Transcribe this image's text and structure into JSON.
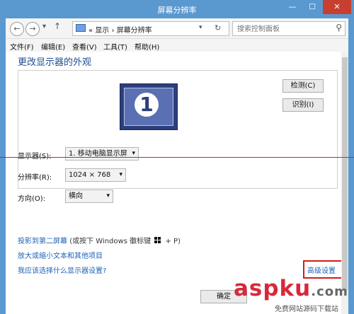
{
  "window": {
    "title": "屏幕分辨率",
    "minimize": "—",
    "maximize": "☐",
    "close": "✕"
  },
  "toolbar": {
    "back": "←",
    "forward": "→",
    "recent": "▾",
    "up": "↑",
    "breadcrumb_sep": "«",
    "path": [
      "显示",
      "屏幕分辨率"
    ],
    "path_arrow": "›",
    "address_dropdown": "▾",
    "refresh": "↻",
    "search_placeholder": "搜索控制面板",
    "search_icon": "⚲"
  },
  "menu": [
    "文件(F)",
    "编辑(E)",
    "查看(V)",
    "工具(T)",
    "帮助(H)"
  ],
  "main": {
    "heading": "更改显示器的外观",
    "monitor_number": "1",
    "detect_button": "检测(C)",
    "identify_button": "识别(I)",
    "display_label": "显示器(S):",
    "display_value": "1. 移动电脑显示屏",
    "resolution_label": "分辨率(R):",
    "resolution_value": "1024 × 768",
    "orientation_label": "方向(O):",
    "orientation_value": "横向",
    "advanced_link": "高级设置",
    "project_link": "投影到第二屏幕",
    "project_hint_before": "(或按下 Windows 徽标键",
    "project_hint_after": "+ P)",
    "text_size_link": "放大或缩小文本和其他项目",
    "which_settings_link": "我应该选择什么显示器设置?",
    "ok_button": "确定",
    "select_arrow": "▾"
  },
  "watermark": {
    "brand": "aspku",
    "tld": ".com",
    "subtitle": "免费网站源码下载站"
  },
  "colors": {
    "titlebar": "#5a98d0",
    "link": "#1e63b8",
    "heading": "#1e4d8f",
    "highlight": "#d61b1b"
  }
}
